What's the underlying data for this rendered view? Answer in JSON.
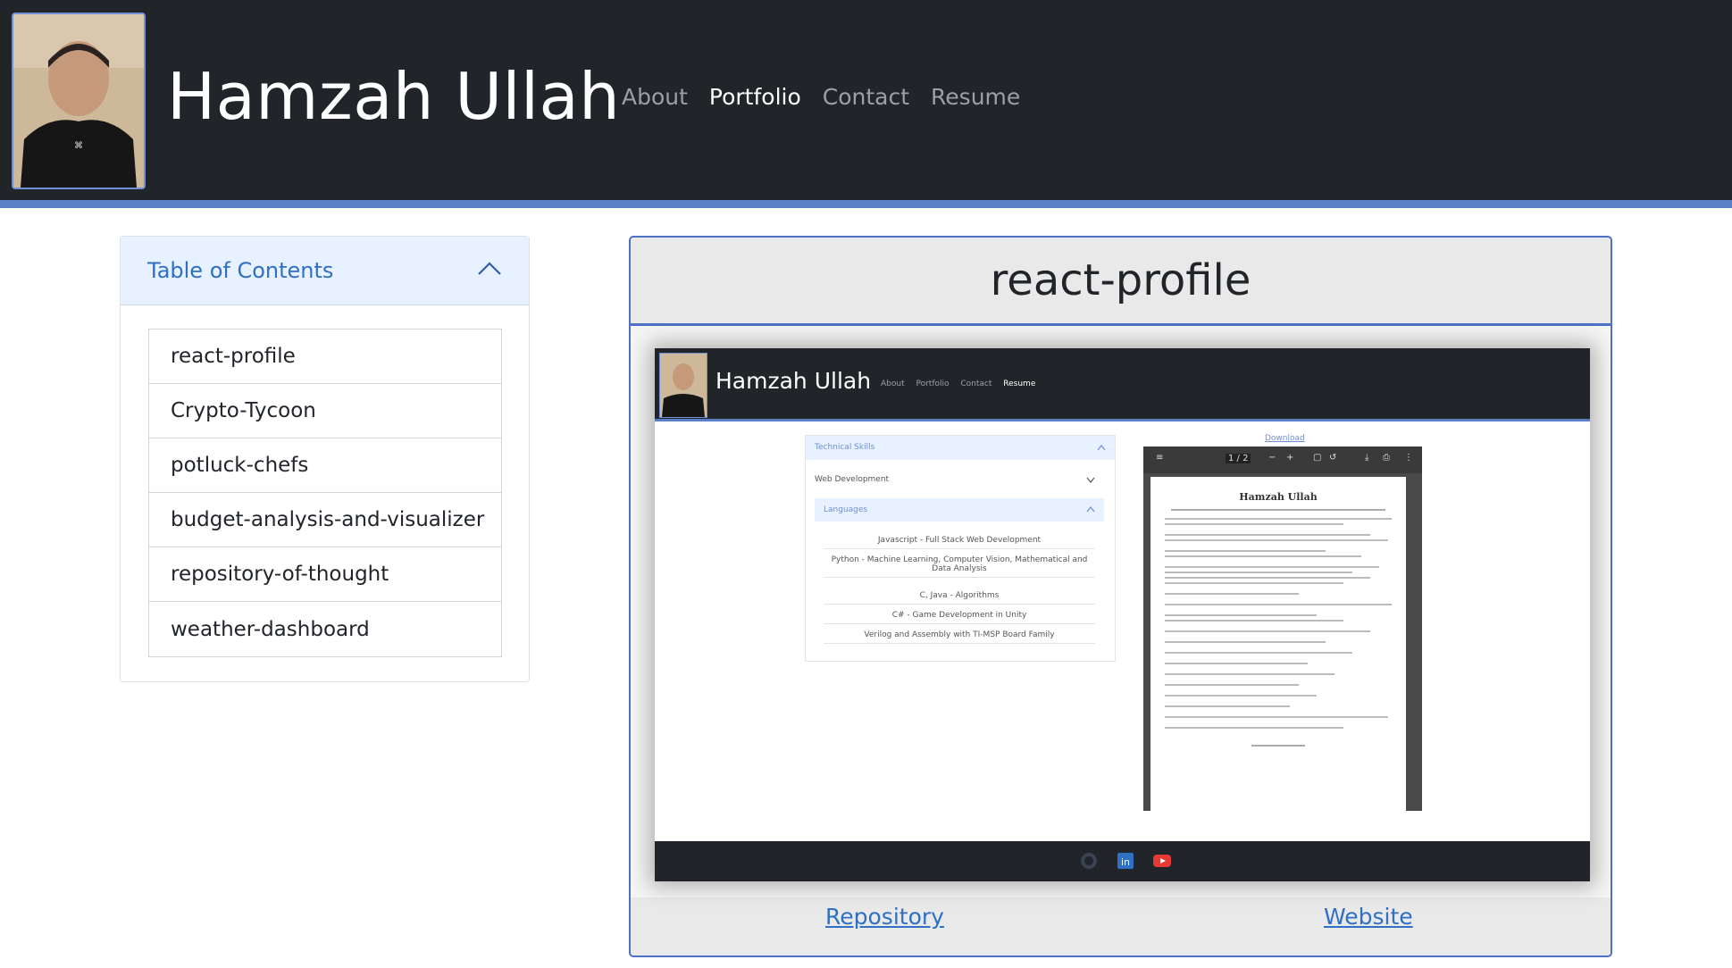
{
  "header": {
    "site_title": "Hamzah Ullah",
    "nav": [
      {
        "label": "About",
        "active": false
      },
      {
        "label": "Portfolio",
        "active": true
      },
      {
        "label": "Contact",
        "active": false
      },
      {
        "label": "Resume",
        "active": false
      }
    ]
  },
  "toc": {
    "title": "Table of Contents",
    "toggle_icon": "chevron-up-icon",
    "items": [
      "react-profile",
      "Crypto-Tycoon",
      "potluck-chefs",
      "budget-analysis-and-visualizer",
      "repository-of-thought",
      "weather-dashboard"
    ]
  },
  "project": {
    "title": "react-profile",
    "repository_label": "Repository",
    "website_label": "Website",
    "preview": {
      "site_title": "Hamzah Ullah",
      "nav": [
        "About",
        "Portfolio",
        "Contact",
        "Resume"
      ],
      "skills_header": "Technical Skills",
      "web_dev_label": "Web Development",
      "languages_label": "Languages",
      "languages": [
        "Javascript - Full Stack Web Development",
        "Python - Machine Learning, Computer Vision, Mathematical and Data Analysis",
        "C, Java - Algorithms",
        "C# - Game Development in Unity",
        "Verilog and Assembly with TI-MSP Board Family"
      ],
      "download_label": "Download",
      "pdf_page_indicator": "1 / 2",
      "resume_name": "Hamzah Ullah",
      "footer_icons": [
        "github-icon",
        "linkedin-icon",
        "youtube-icon"
      ]
    }
  },
  "colors": {
    "header_bg": "#212529",
    "accent": "#5b7fc7",
    "link": "#2f6fc4",
    "toc_header_bg": "#e7f1ff"
  }
}
